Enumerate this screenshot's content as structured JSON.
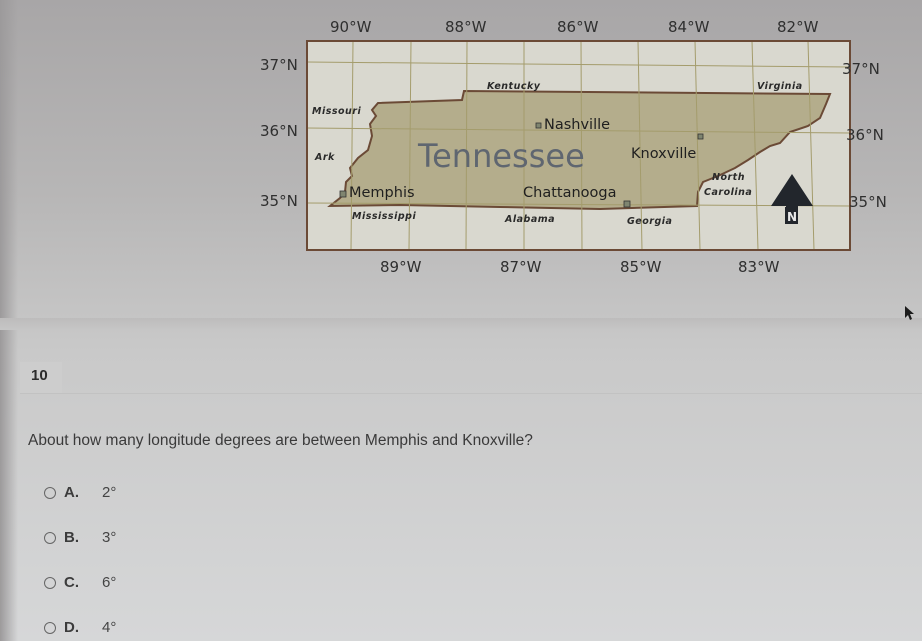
{
  "map": {
    "title": "Tennessee",
    "top_longitudes": [
      "90°W",
      "88°W",
      "86°W",
      "84°W",
      "82°W"
    ],
    "bottom_longitudes": [
      "89°W",
      "87°W",
      "85°W",
      "83°W"
    ],
    "left_latitudes": [
      "37°N",
      "36°N",
      "35°N"
    ],
    "right_latitudes": [
      "37°N",
      "36°N",
      "35°N"
    ],
    "neighbor_states": {
      "kentucky": "Kentucky",
      "virginia": "Virginia",
      "missouri": "Missouri",
      "arkansas": "Ark",
      "mississippi": "Mississippi",
      "alabama": "Alabama",
      "georgia": "Georgia",
      "north_carolina_line1": "North",
      "north_carolina_line2": "Carolina"
    },
    "cities": {
      "nashville": "Nashville",
      "knoxville": "Knoxville",
      "memphis": "Memphis",
      "chattanooga": "Chattanooga"
    },
    "compass_label": "N",
    "colors": {
      "state_fill": "#b4ad8c",
      "border": "#6b4a36",
      "grid": "#a49c6c",
      "background": "#d9d8cf"
    }
  },
  "question": {
    "number": "10",
    "text": "About how many longitude degrees are between Memphis and Knoxville?",
    "options": [
      {
        "letter": "A.",
        "value": "2°"
      },
      {
        "letter": "B.",
        "value": "3°"
      },
      {
        "letter": "C.",
        "value": "6°"
      },
      {
        "letter": "D.",
        "value": "4°"
      }
    ]
  }
}
